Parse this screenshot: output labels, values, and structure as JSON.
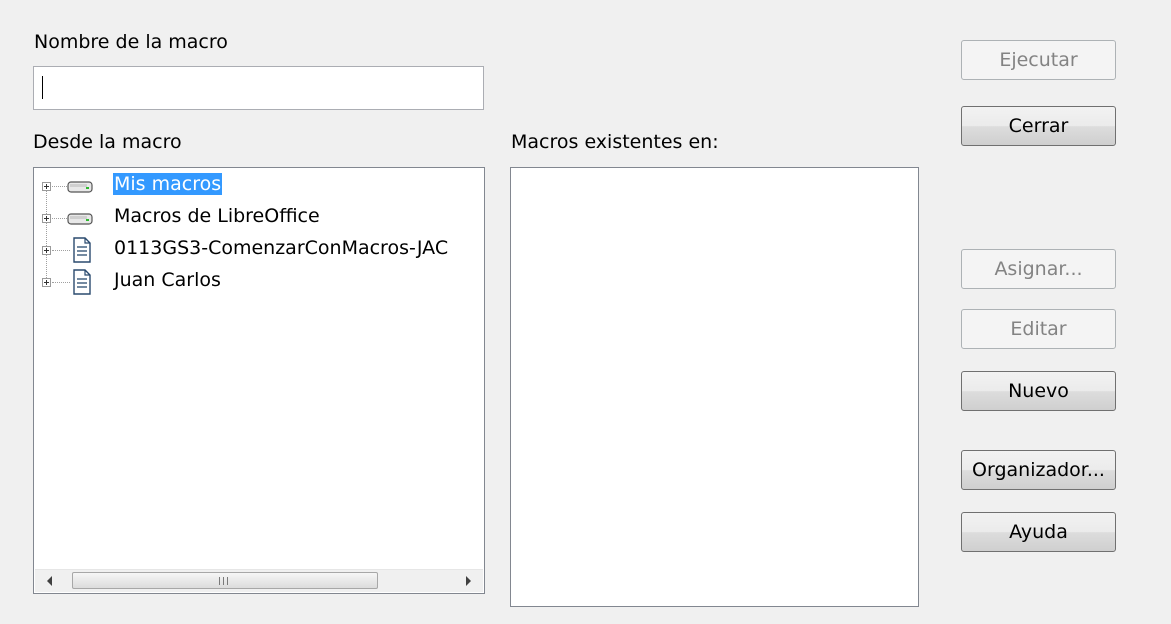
{
  "dialog": {
    "macro_name_label": "Nombre de la macro",
    "macro_name_value": "",
    "from_macro_label": "Desde la macro",
    "existing_macros_label": "Macros existentes en:"
  },
  "tree": {
    "items": [
      {
        "label": "Mis macros",
        "icon": "drive-icon",
        "selected": true
      },
      {
        "label": "Macros de LibreOffice",
        "icon": "drive-icon",
        "selected": false
      },
      {
        "label": "0113GS3-ComenzarConMacros-JAC",
        "icon": "document-icon",
        "selected": false
      },
      {
        "label": "Juan Carlos",
        "icon": "document-icon",
        "selected": false
      }
    ]
  },
  "buttons": {
    "run": "Ejecutar",
    "close": "Cerrar",
    "assign": "Asignar...",
    "edit": "Editar",
    "new": "Nuevo",
    "organizer": "Organizador...",
    "help": "Ayuda"
  },
  "colors": {
    "selection": "#3399ff",
    "window_bg": "#f0f0f0"
  }
}
